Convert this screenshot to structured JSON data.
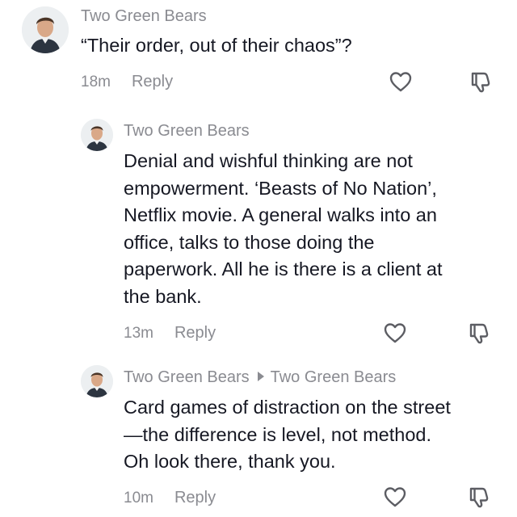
{
  "comments": [
    {
      "author": "Two Green Bears",
      "reply_to": "",
      "text": "“Their order, out of their chaos”?",
      "time": "18m",
      "reply_label": "Reply"
    },
    {
      "author": "Two Green Bears",
      "reply_to": "",
      "text": "Denial and wishful thinking are not\nempowerment. ‘Beasts of No Nation’,\nNetflix movie. A general walks into an\noffice, talks to those doing the\npaperwork. All he is there is a client at\nthe bank.",
      "time": "13m",
      "reply_label": "Reply"
    },
    {
      "author": "Two Green Bears",
      "reply_to": "Two Green Bears",
      "text": "Card games of distraction on the street\n—the difference is level, not method.\nOh look there, thank you.",
      "time": "10m",
      "reply_label": "Reply"
    }
  ],
  "icons": {
    "like": "heart-outline-icon",
    "dislike": "thumbs-down-outline-icon",
    "reply_arrow": "caret-right-icon"
  },
  "colors": {
    "text": "#161823",
    "muted": "#8a8b91",
    "icon": "#5c5d63"
  }
}
